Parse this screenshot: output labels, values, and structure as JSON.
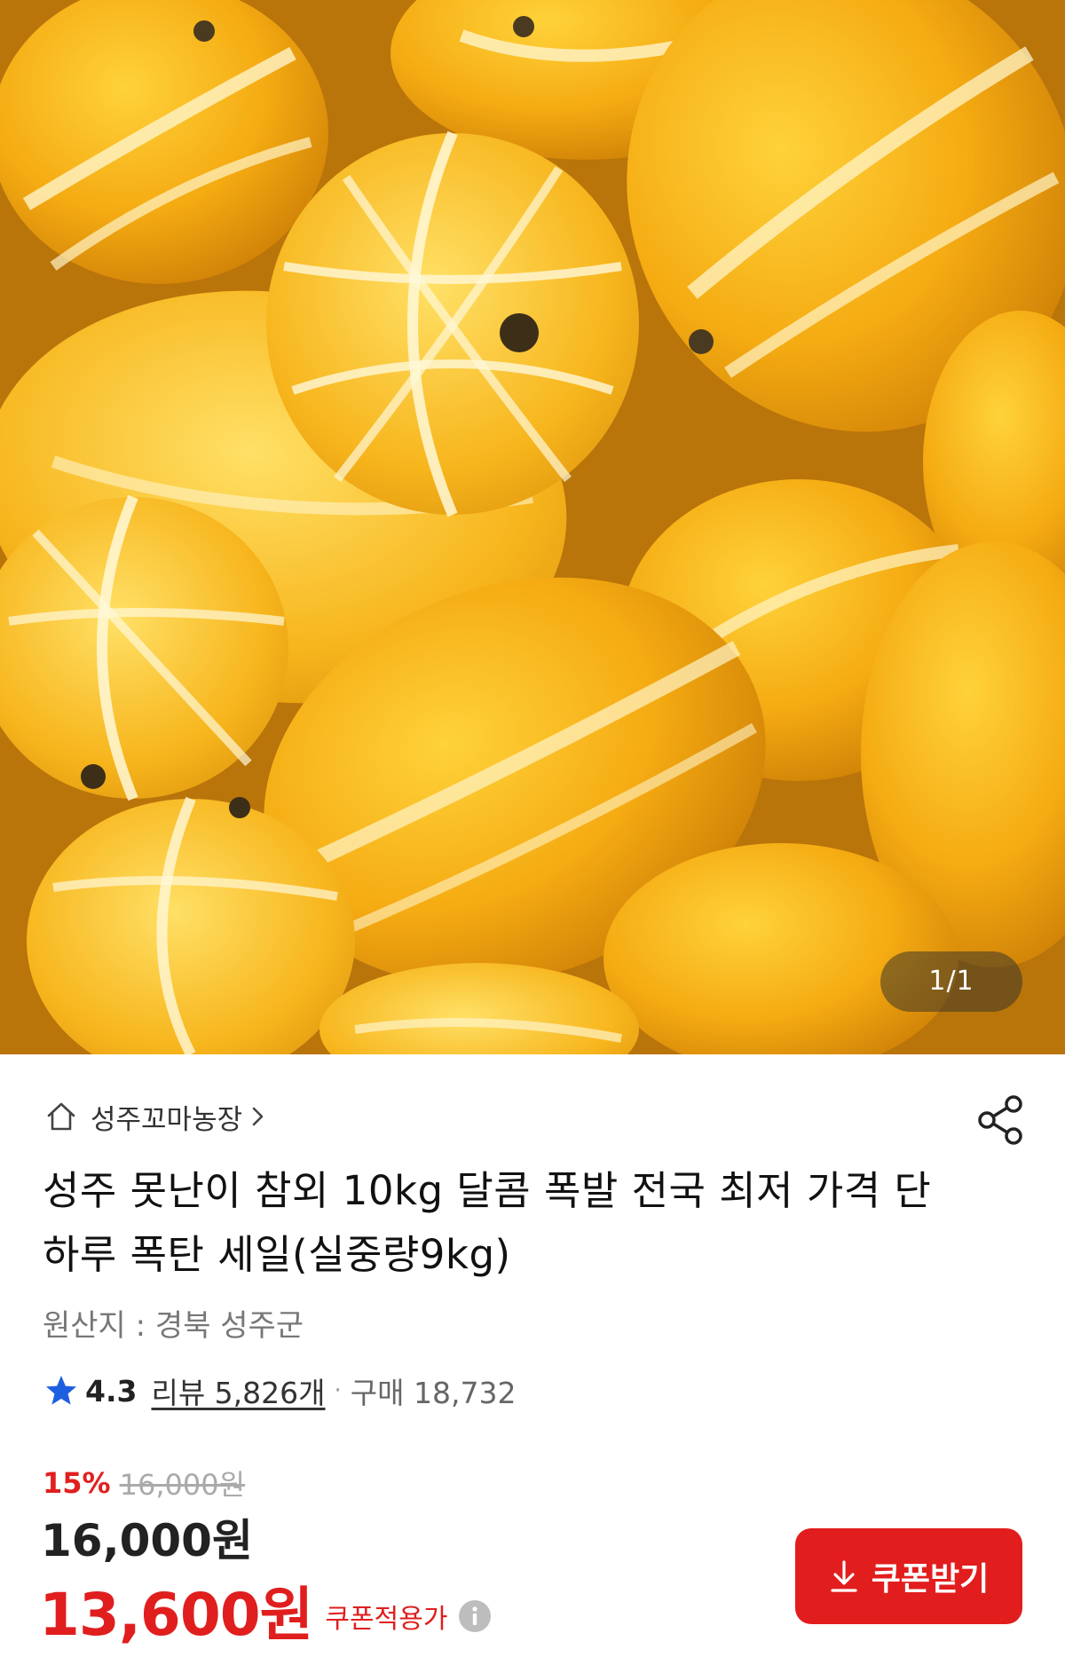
{
  "gallery": {
    "counter": "1/1",
    "image_icon": "korean-melon-photo"
  },
  "store": {
    "name": "성주꼬마농장",
    "icon": "home-icon",
    "chevron": "chevron-right-icon"
  },
  "share": {
    "icon": "share-icon"
  },
  "product": {
    "title": "성주 못난이 참외  10kg 달콤 폭발 전국 최저 가격 단 하루 폭탄 세일(실중량9kg)",
    "origin": "원산지 : 경북 성주군"
  },
  "rating": {
    "icon": "star-icon",
    "score": "4.3",
    "review_text": "리뷰 5,826개",
    "separator": "·",
    "purchase_text": "구매 18,732",
    "star_color": "#1e5fe0"
  },
  "price": {
    "discount": "15%",
    "original": "16,000원",
    "current": "16,000원",
    "coupon_price": "13,600원",
    "coupon_label": "쿠폰적용가",
    "info_icon": "info-icon",
    "accent_color": "#e01e1e"
  },
  "coupon_button": {
    "label": "쿠폰받기",
    "icon": "download-icon",
    "color": "#e21d1d"
  }
}
